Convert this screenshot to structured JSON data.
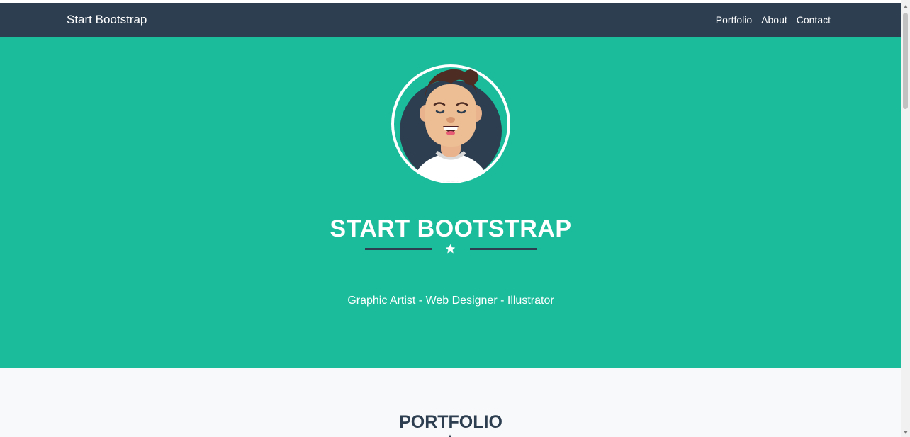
{
  "navbar": {
    "brand": "Start Bootstrap",
    "links": [
      "Portfolio",
      "About",
      "Contact"
    ]
  },
  "masthead": {
    "avatar_icon": "avataaars-icon",
    "title": "START BOOTSTRAP",
    "divider_icon": "star-icon",
    "subtitle": "Graphic Artist - Web Designer - Illustrator"
  },
  "portfolio": {
    "heading": "PORTFOLIO",
    "divider_icon": "star-icon"
  },
  "colors": {
    "navbar_bg": "#2c3e50",
    "masthead_bg": "#1abc9c",
    "section_bg": "#f8f9fa",
    "text_light": "#ffffff",
    "text_dark": "#2c3e50"
  }
}
